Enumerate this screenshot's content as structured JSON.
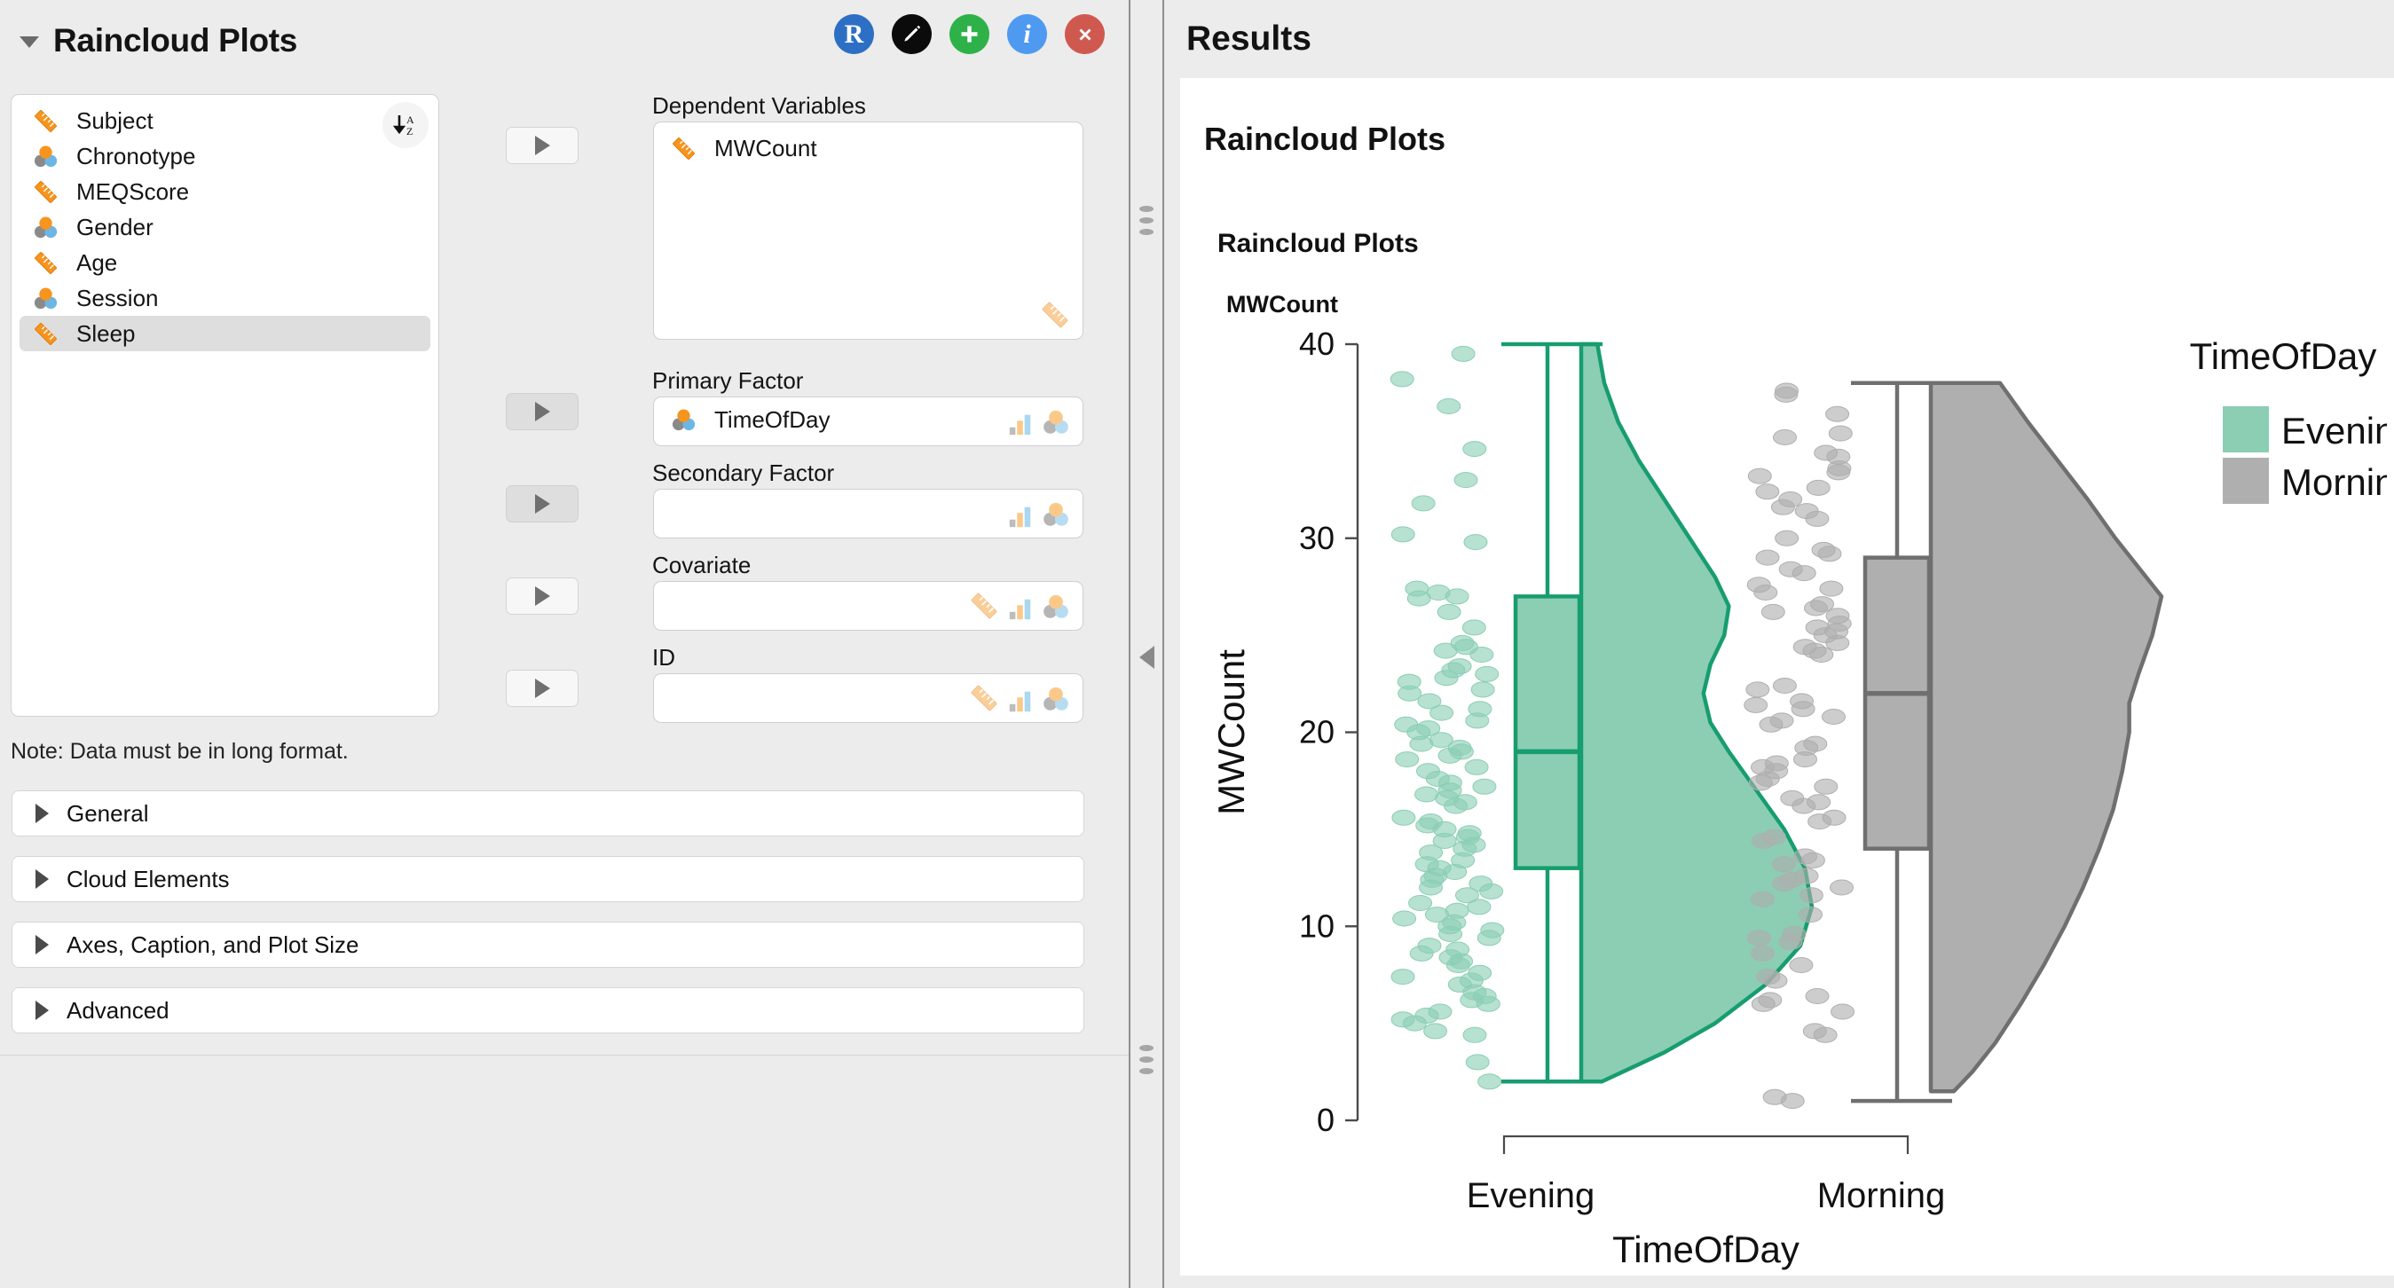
{
  "options_panel": {
    "title": "Raincloud Plots",
    "collapse_icon": "caret-down-icon",
    "header_buttons": [
      {
        "name": "r-syntax-button",
        "glyph": "R",
        "color": "#2d6fc4"
      },
      {
        "name": "edit-button",
        "glyph": "pencil-icon",
        "color": "#0b0b0b"
      },
      {
        "name": "add-button",
        "glyph": "+",
        "color": "#2fb14a"
      },
      {
        "name": "info-button",
        "glyph": "i",
        "color": "#4e9af1"
      },
      {
        "name": "close-button",
        "glyph": "x",
        "color": "#d0594f"
      }
    ],
    "variable_list": {
      "sort_icon": "sort-az-icon",
      "items": [
        {
          "label": "Subject",
          "type": "continuous",
          "selected": false
        },
        {
          "label": "Chronotype",
          "type": "nominal",
          "selected": false
        },
        {
          "label": "MEQScore",
          "type": "continuous",
          "selected": false
        },
        {
          "label": "Gender",
          "type": "nominal",
          "selected": false
        },
        {
          "label": "Age",
          "type": "continuous",
          "selected": false
        },
        {
          "label": "Session",
          "type": "nominal",
          "selected": false
        },
        {
          "label": "Sleep",
          "type": "continuous",
          "selected": true
        }
      ]
    },
    "fields": [
      {
        "label": "Dependent Variables",
        "kind": "listbox",
        "value": "MWCount",
        "value_type": "continuous",
        "placeholder": "",
        "permitted": [
          "continuous"
        ]
      },
      {
        "label": "Primary Factor",
        "kind": "single",
        "value": "TimeOfDay",
        "value_type": "nominal",
        "placeholder": "",
        "permitted": [
          "ordinal",
          "nominal"
        ]
      },
      {
        "label": "Secondary Factor",
        "kind": "single",
        "value": "",
        "value_type": "",
        "placeholder": "",
        "permitted": [
          "ordinal",
          "nominal"
        ]
      },
      {
        "label": "Covariate",
        "kind": "single",
        "value": "",
        "value_type": "",
        "placeholder": "",
        "permitted": [
          "continuous",
          "ordinal",
          "nominal"
        ]
      },
      {
        "label": "ID",
        "kind": "single",
        "value": "",
        "value_type": "",
        "placeholder": "",
        "permitted": [
          "continuous",
          "ordinal",
          "nominal"
        ]
      }
    ],
    "note": "Note: Data must be in long format.",
    "sections": [
      {
        "label": "General",
        "expanded": false
      },
      {
        "label": "Cloud Elements",
        "expanded": false
      },
      {
        "label": "Axes, Caption, and Plot Size",
        "expanded": false
      },
      {
        "label": "Advanced",
        "expanded": false
      }
    ]
  },
  "splitter": {
    "collapse_icon": "caret-left-icon",
    "grip_icon": "drag-grip-icon"
  },
  "results_panel": {
    "header_title": "Results",
    "heading_1": "Raincloud Plots",
    "heading_2": "Raincloud Plots",
    "heading_3": "MWCount"
  },
  "chart_data": {
    "type": "raincloud",
    "title": "",
    "xlabel": "TimeOfDay",
    "ylabel": "MWCount",
    "ylim": [
      0,
      40
    ],
    "yticks": [
      0,
      10,
      20,
      30,
      40
    ],
    "categories": [
      "Evening",
      "Morning"
    ],
    "grid": false,
    "legend": {
      "title": "TimeOfDay",
      "position": "right",
      "entries": [
        {
          "label": "Evening",
          "color": "#8bceb4"
        },
        {
          "label": "Morning",
          "color": "#afafaf"
        }
      ]
    },
    "series": [
      {
        "name": "Evening",
        "fill": "#8bceb4",
        "stroke": "#179d6f",
        "box": {
          "q1": 13.0,
          "median": 19.0,
          "q3": 27.0,
          "whisker_low": 2.0,
          "whisker_high": 40.0
        },
        "density": [
          {
            "y": 40.0,
            "w": 0.07
          },
          {
            "y": 38.0,
            "w": 0.1
          },
          {
            "y": 36.0,
            "w": 0.16
          },
          {
            "y": 34.0,
            "w": 0.25
          },
          {
            "y": 32.0,
            "w": 0.36
          },
          {
            "y": 30.0,
            "w": 0.47
          },
          {
            "y": 28.0,
            "w": 0.58
          },
          {
            "y": 26.5,
            "w": 0.64
          },
          {
            "y": 25.0,
            "w": 0.62
          },
          {
            "y": 23.5,
            "w": 0.56
          },
          {
            "y": 22.0,
            "w": 0.53
          },
          {
            "y": 20.5,
            "w": 0.56
          },
          {
            "y": 19.0,
            "w": 0.64
          },
          {
            "y": 17.0,
            "w": 0.76
          },
          {
            "y": 15.0,
            "w": 0.88
          },
          {
            "y": 13.0,
            "w": 0.97
          },
          {
            "y": 11.0,
            "w": 1.0
          },
          {
            "y": 9.0,
            "w": 0.95
          },
          {
            "y": 7.0,
            "w": 0.8
          },
          {
            "y": 5.0,
            "w": 0.58
          },
          {
            "y": 3.5,
            "w": 0.36
          },
          {
            "y": 2.5,
            "w": 0.18
          },
          {
            "y": 2.0,
            "w": 0.09
          }
        ],
        "points": [
          39.5,
          38.2,
          36.8,
          34.6,
          33.0,
          31.8,
          30.2,
          29.8,
          27.4,
          27.2,
          27.0,
          26.9,
          26.2,
          25.4,
          24.6,
          24.4,
          24.2,
          24.0,
          23.4,
          23.2,
          23.0,
          22.8,
          22.6,
          22.2,
          22.0,
          21.6,
          21.2,
          21.0,
          20.6,
          20.4,
          20.2,
          20.0,
          19.6,
          19.4,
          19.2,
          19.0,
          18.8,
          18.6,
          18.2,
          18.0,
          17.6,
          17.4,
          17.2,
          17.0,
          16.8,
          16.6,
          16.4,
          16.2,
          15.6,
          15.4,
          15.2,
          15.0,
          14.8,
          14.6,
          14.4,
          14.2,
          14.0,
          13.8,
          13.4,
          13.2,
          13.0,
          12.8,
          12.6,
          12.4,
          12.2,
          12.0,
          11.8,
          11.6,
          11.2,
          11.0,
          10.8,
          10.6,
          10.4,
          10.2,
          10.0,
          9.8,
          9.6,
          9.4,
          9.0,
          8.8,
          8.6,
          8.4,
          8.2,
          8.0,
          7.6,
          7.4,
          7.2,
          7.0,
          6.6,
          6.4,
          6.2,
          6.0,
          5.6,
          5.4,
          5.2,
          5.0,
          4.6,
          4.4,
          3.0,
          2.0
        ]
      },
      {
        "name": "Morning",
        "fill": "#afafaf",
        "stroke": "#6f6f6f",
        "box": {
          "q1": 14.0,
          "median": 22.0,
          "q3": 29.0,
          "whisker_low": 1.0,
          "whisker_high": 38.0
        },
        "density": [
          {
            "y": 38.0,
            "w": 0.3
          },
          {
            "y": 36.0,
            "w": 0.42
          },
          {
            "y": 34.0,
            "w": 0.55
          },
          {
            "y": 32.0,
            "w": 0.68
          },
          {
            "y": 30.0,
            "w": 0.8
          },
          {
            "y": 28.5,
            "w": 0.9
          },
          {
            "y": 27.0,
            "w": 1.0
          },
          {
            "y": 25.0,
            "w": 0.96
          },
          {
            "y": 23.0,
            "w": 0.9
          },
          {
            "y": 21.5,
            "w": 0.86
          },
          {
            "y": 20.0,
            "w": 0.86
          },
          {
            "y": 18.0,
            "w": 0.83
          },
          {
            "y": 16.0,
            "w": 0.79
          },
          {
            "y": 14.0,
            "w": 0.73
          },
          {
            "y": 12.0,
            "w": 0.66
          },
          {
            "y": 10.0,
            "w": 0.58
          },
          {
            "y": 8.0,
            "w": 0.49
          },
          {
            "y": 6.0,
            "w": 0.39
          },
          {
            "y": 4.0,
            "w": 0.28
          },
          {
            "y": 2.5,
            "w": 0.18
          },
          {
            "y": 1.5,
            "w": 0.1
          }
        ],
        "points": [
          37.6,
          37.4,
          36.4,
          35.4,
          35.2,
          34.4,
          34.2,
          33.6,
          33.4,
          33.2,
          32.6,
          32.4,
          32.0,
          31.6,
          31.4,
          31.0,
          30.0,
          29.4,
          29.2,
          29.0,
          28.4,
          28.2,
          27.6,
          27.4,
          27.2,
          26.6,
          26.4,
          26.2,
          26.0,
          25.6,
          25.4,
          25.2,
          25.0,
          24.6,
          24.4,
          24.2,
          24.0,
          22.4,
          22.2,
          21.6,
          21.4,
          21.2,
          20.8,
          20.6,
          20.4,
          19.4,
          19.2,
          18.6,
          18.4,
          18.2,
          18.0,
          17.6,
          17.4,
          17.2,
          16.6,
          16.4,
          16.2,
          15.6,
          15.4,
          14.6,
          14.4,
          13.6,
          13.4,
          13.2,
          12.6,
          12.4,
          12.2,
          12.0,
          11.6,
          11.4,
          10.6,
          9.6,
          9.4,
          9.2,
          8.6,
          8.0,
          7.4,
          7.2,
          6.4,
          6.2,
          6.0,
          5.6,
          4.6,
          4.4,
          1.2,
          1.0
        ]
      }
    ]
  }
}
